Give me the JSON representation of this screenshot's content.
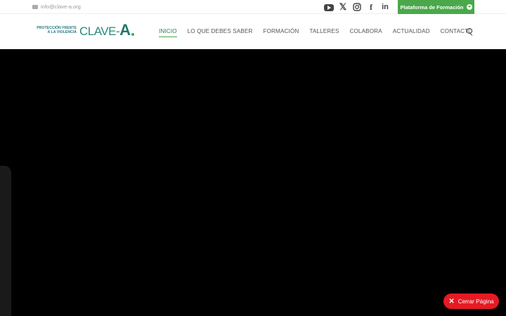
{
  "topbar": {
    "email": "info@clave-a.org",
    "cta_label": "Plataforma de Formación"
  },
  "logo": {
    "tagline_line1": "PROTECCIÓN FRENTE",
    "tagline_line2": "A LA VIOLENCIA",
    "brand_prefix": "CLAVE-",
    "brand_suffix": "A"
  },
  "nav": {
    "items": [
      {
        "label": "INICIO"
      },
      {
        "label": "LO QUE DEBES SABER"
      },
      {
        "label": "FORMACIÓN"
      },
      {
        "label": "TALLERES"
      },
      {
        "label": "COLABORA"
      },
      {
        "label": "ACTUALIDAD"
      },
      {
        "label": "CONTACTO"
      }
    ]
  },
  "close_button": {
    "label": "Cerrar Página"
  },
  "colors": {
    "accent_green": "#4aa84a",
    "brand_teal": "#2a8a7a",
    "close_red": "#e51b24"
  }
}
